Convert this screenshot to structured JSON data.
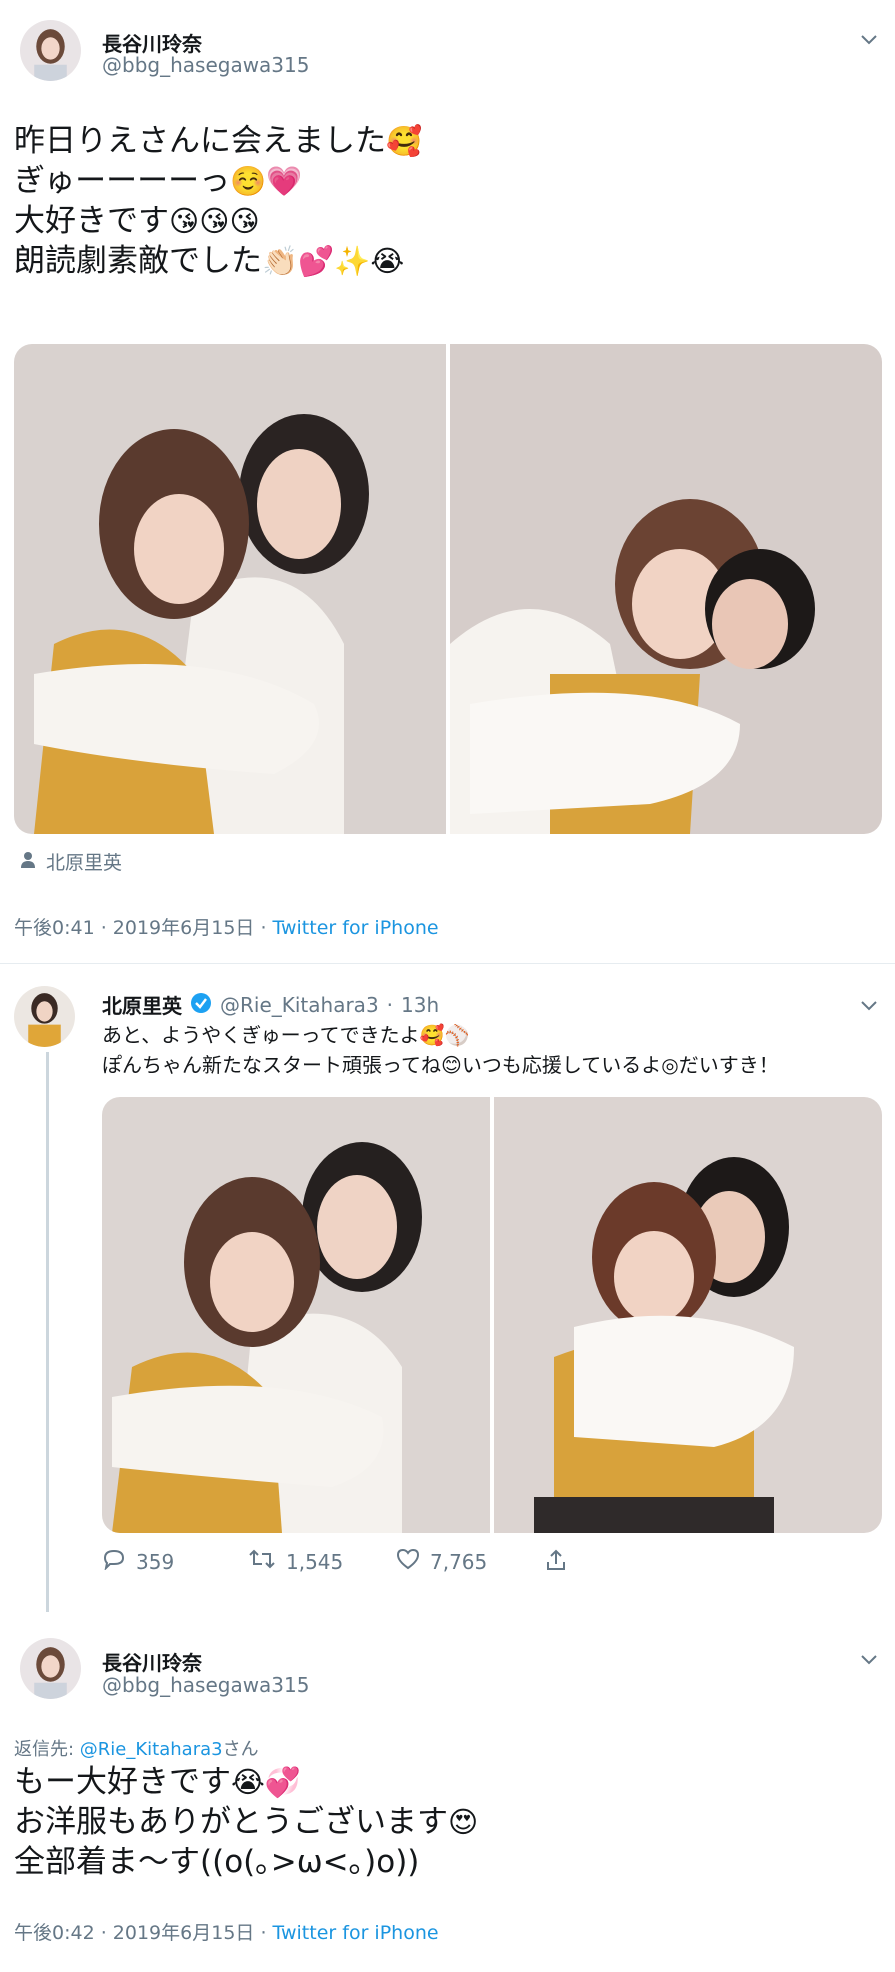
{
  "tweet1": {
    "name": "長谷川玲奈",
    "handle": "@bbg_hasegawa315",
    "lines": [
      {
        "text": "昨日りえさんに会えました",
        "emojis": "🥰"
      },
      {
        "text": "ぎゅーーーーっ",
        "emojis": "☺️💗"
      },
      {
        "text": "大好きです",
        "emojis": "😘😘😘"
      },
      {
        "text": "朗読劇素敵でした",
        "emojis": "👏🏻💕✨😭"
      }
    ],
    "tagged_user": "北原里英",
    "time": "午後0:41 · 2019年6月15日 · ",
    "source": "Twitter for iPhone"
  },
  "tweet2": {
    "name": "北原里英",
    "handle": "@Rie_Kitahara3",
    "age": "13h",
    "line1": {
      "text": "あと、ようやくぎゅーってできたよ",
      "emojis": "🥰⚾"
    },
    "line2": {
      "text": "ぽんちゃん新たなスタート頑張ってね",
      "emoji": "😊",
      "text_after": "いつも応援しているよ◎だいすき！"
    },
    "replies": "359",
    "retweets": "1,545",
    "likes": "7,765"
  },
  "tweet3": {
    "name": "長谷川玲奈",
    "handle": "@bbg_hasegawa315",
    "reply_prefix": "返信先: ",
    "reply_to": "@Rie_Kitahara3",
    "reply_suffix": "さん",
    "lines": [
      {
        "text": "もー大好きです",
        "emojis": "😭💞"
      },
      {
        "text": "お洋服もありがとうございます",
        "emojis": "😍"
      },
      {
        "text": "全部着ま〜す((o(｡>ω<｡)o))",
        "emojis": ""
      }
    ],
    "time": "午後0:42 · 2019年6月15日 · ",
    "source": "Twitter for iPhone"
  },
  "colors": {
    "link": "#1b95e0",
    "muted": "#657786",
    "verified": "#1da1f2",
    "divider": "#e6ecf0"
  },
  "icons": [
    "chevron-down-icon",
    "person-icon",
    "verified-badge-icon",
    "reply-icon",
    "retweet-icon",
    "like-icon",
    "share-icon"
  ]
}
